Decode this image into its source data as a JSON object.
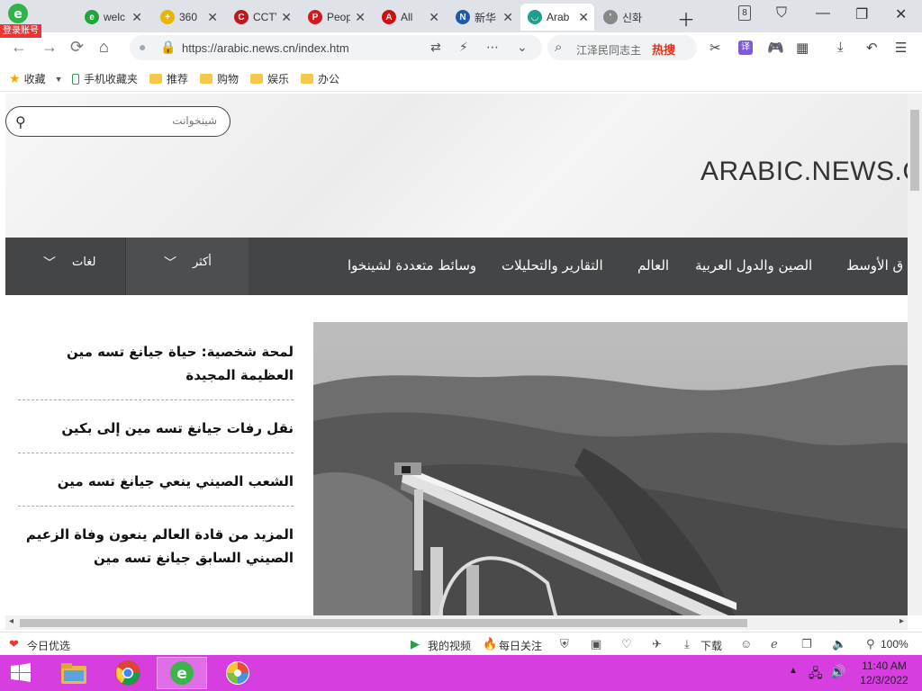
{
  "browser": {
    "login_badge": "登录账号",
    "tabs": [
      {
        "title": "welc",
        "favicon_color": "#21a53b",
        "favicon_char": "e"
      },
      {
        "title": "360",
        "favicon_color": "#e8b600",
        "favicon_char": "+"
      },
      {
        "title": "CCTV",
        "favicon_color": "#c0151b",
        "favicon_char": "C"
      },
      {
        "title": "People",
        "favicon_color": "#d3181e",
        "favicon_char": "P"
      },
      {
        "title": "All",
        "favicon_color": "#cc1010",
        "favicon_char": "A"
      },
      {
        "title": "新华",
        "favicon_color": "#1e5aa8",
        "favicon_char": "N"
      },
      {
        "title": "Arab",
        "favicon_color": "#1f9e8a",
        "favicon_char": "◡"
      },
      {
        "title": "신화",
        "favicon_color": "#888888",
        "favicon_char": "'"
      }
    ],
    "active_tab_index": 6,
    "tab_count": "8",
    "url": "https://arabic.news.cn/index.htm",
    "search_placeholder": "江泽民同志主",
    "search_hot_label": "热搜"
  },
  "bookmarks": [
    {
      "label": "收藏",
      "icon": "star-icon"
    },
    {
      "label": "手机收藏夹",
      "icon": "phone-icon"
    },
    {
      "label": "推荐",
      "icon": "folder-icon"
    },
    {
      "label": "购物",
      "icon": "folder-icon"
    },
    {
      "label": "娱乐",
      "icon": "folder-icon"
    },
    {
      "label": "办公",
      "icon": "folder-icon"
    }
  ],
  "site": {
    "search_placeholder": "شينخوانت",
    "logo_text": "ARABIC.NEWS.C",
    "dropdowns": [
      {
        "label": "لغات"
      },
      {
        "label": "أكثر"
      }
    ],
    "menu": [
      "وسائط متعددة لشينخوا",
      "التقارير والتحليلات",
      "العالم",
      "الصين والدول العربية",
      "ق الأوسط"
    ],
    "news": [
      "لمحة شخصية: حياة جيانغ تسه مين العظيمة المجيدة",
      "نقل رفات جيانغ تسه مين إلى بكين",
      "الشعب الصيني ينعي جيانغ تسه مين",
      "المزيد من قادة العالم ينعون وفاة الزعيم الصيني السابق جيانغ تسه مين"
    ]
  },
  "statusbar": {
    "left_label": "今日优选",
    "my_video": "我的视频",
    "daily_follow": "每日关注",
    "download": "下载",
    "zoom": "100%"
  },
  "taskbar": {
    "time": "11:40 AM",
    "date": "12/3/2022"
  },
  "colors": {
    "taskbar": "#d63ee0",
    "menubar": "#444546",
    "hot": "#e0331b"
  }
}
